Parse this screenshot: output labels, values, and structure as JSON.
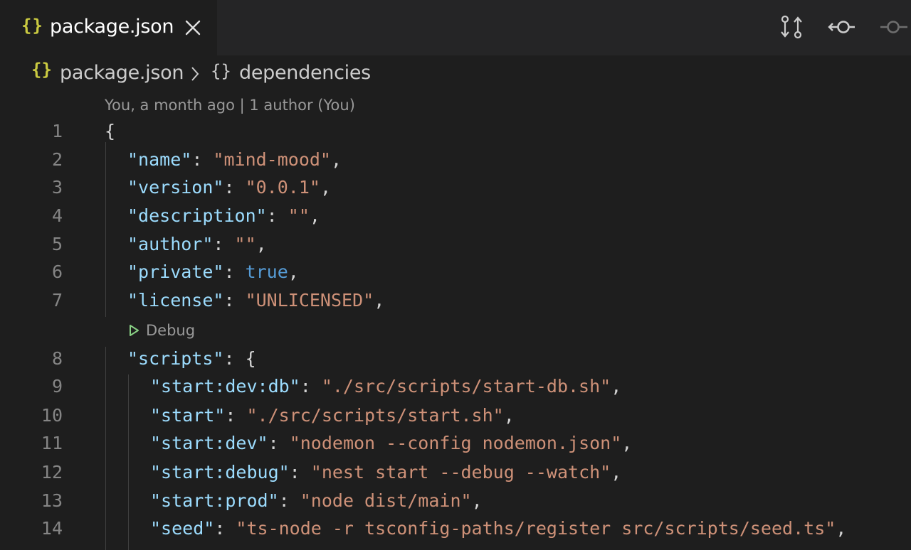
{
  "tab": {
    "icon": "{}",
    "label": "package.json"
  },
  "toolbar": {
    "icons": [
      "compare-changes-icon",
      "git-previous-change-icon",
      "git-next-change-icon"
    ]
  },
  "breadcrumb": {
    "file_icon": "{}",
    "file": "package.json",
    "separator": ">",
    "symbol_icon": "{}",
    "symbol": "dependencies"
  },
  "codelens": {
    "blame": "You, a month ago | 1 author (You)",
    "debug": "Debug"
  },
  "colors": {
    "editor_bg": "#1e1e1e",
    "tabbar_bg": "#252526",
    "json_icon": "#cbcb41",
    "key": "#9cdcfe",
    "string": "#ce9178",
    "boolean": "#569cd6",
    "debug_green": "#89d185"
  },
  "lines": [
    {
      "num": "1",
      "indent": 0,
      "text": "{"
    },
    {
      "num": "2",
      "indent": 1,
      "key": "\"name\"",
      "value": "\"mind-mood\"",
      "vtype": "string",
      "tail": ","
    },
    {
      "num": "3",
      "indent": 1,
      "key": "\"version\"",
      "value": "\"0.0.1\"",
      "vtype": "string",
      "tail": ","
    },
    {
      "num": "4",
      "indent": 1,
      "key": "\"description\"",
      "value": "\"\"",
      "vtype": "string",
      "tail": ","
    },
    {
      "num": "5",
      "indent": 1,
      "key": "\"author\"",
      "value": "\"\"",
      "vtype": "string",
      "tail": ","
    },
    {
      "num": "6",
      "indent": 1,
      "key": "\"private\"",
      "value": "true",
      "vtype": "boolean",
      "tail": ","
    },
    {
      "num": "7",
      "indent": 1,
      "key": "\"license\"",
      "value": "\"UNLICENSED\"",
      "vtype": "string",
      "tail": ","
    },
    {
      "num": "8",
      "indent": 1,
      "key": "\"scripts\"",
      "value": "{",
      "vtype": "punct",
      "tail": ""
    },
    {
      "num": "9",
      "indent": 2,
      "key": "\"start:dev:db\"",
      "value": "\"./src/scripts/start-db.sh\"",
      "vtype": "string",
      "tail": ","
    },
    {
      "num": "10",
      "indent": 2,
      "key": "\"start\"",
      "value": "\"./src/scripts/start.sh\"",
      "vtype": "string",
      "tail": ","
    },
    {
      "num": "11",
      "indent": 2,
      "key": "\"start:dev\"",
      "value": "\"nodemon --config nodemon.json\"",
      "vtype": "string",
      "tail": ","
    },
    {
      "num": "12",
      "indent": 2,
      "key": "\"start:debug\"",
      "value": "\"nest start --debug --watch\"",
      "vtype": "string",
      "tail": ","
    },
    {
      "num": "13",
      "indent": 2,
      "key": "\"start:prod\"",
      "value": "\"node dist/main\"",
      "vtype": "string",
      "tail": ","
    },
    {
      "num": "14",
      "indent": 2,
      "key": "\"seed\"",
      "value": "\"ts-node -r tsconfig-paths/register src/scripts/seed.ts\"",
      "vtype": "string",
      "tail": ","
    }
  ]
}
